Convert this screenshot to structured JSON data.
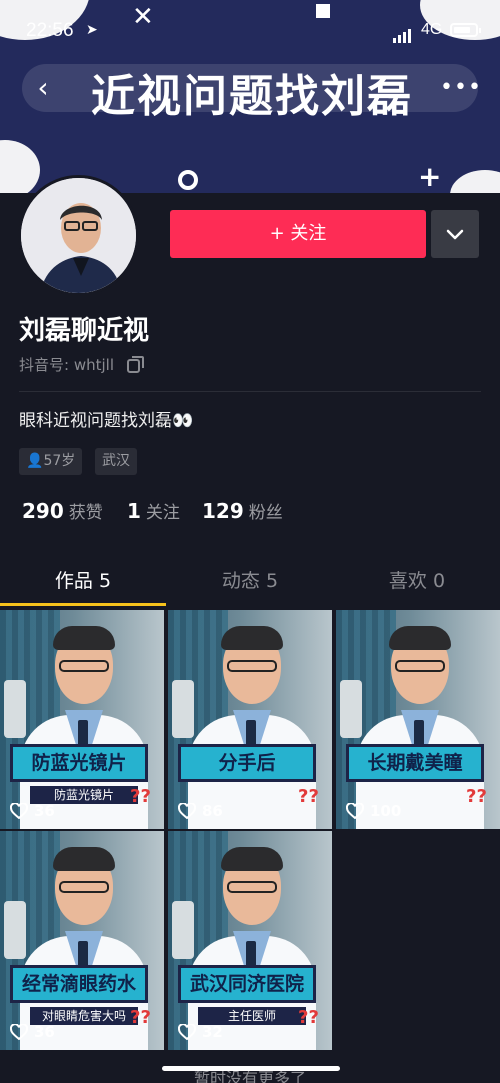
{
  "status_bar": {
    "time": "22:56",
    "network": "4G"
  },
  "banner": {
    "title": "近视问题找刘磊"
  },
  "profile": {
    "follow_label": "+ 关注",
    "name": "刘磊聊近视",
    "douyin_id": "抖音号: whtjll",
    "bio": "眼科近视问题找刘磊👀",
    "tags": [
      "57岁",
      "武汉"
    ],
    "stats": [
      {
        "value": "290",
        "label": "获赞"
      },
      {
        "value": "1",
        "label": "关注"
      },
      {
        "value": "129",
        "label": "粉丝"
      }
    ]
  },
  "tabs": [
    {
      "label": "作品 5",
      "active": true
    },
    {
      "label": "动态 5",
      "active": false
    },
    {
      "label": "喜欢 0",
      "active": false
    }
  ],
  "videos": [
    {
      "caption": "防蓝光镜片",
      "subcaption": "防蓝光镜片",
      "likes": "36"
    },
    {
      "caption": "分手后",
      "subcaption": "",
      "likes": "86"
    },
    {
      "caption": "长期戴美瞳",
      "subcaption": "",
      "likes": "100"
    },
    {
      "caption": "经常滴眼药水",
      "subcaption": "对眼睛危害大吗",
      "likes": "36"
    },
    {
      "caption": "武汉同济医院",
      "subcaption": "主任医师",
      "likes": "32"
    }
  ],
  "footer": {
    "text": "暂时没有更多了"
  },
  "colors": {
    "background": "#161823",
    "follow_button": "#fe2c55",
    "tab_underline": "#f6c21c",
    "banner": "#232a5c"
  }
}
